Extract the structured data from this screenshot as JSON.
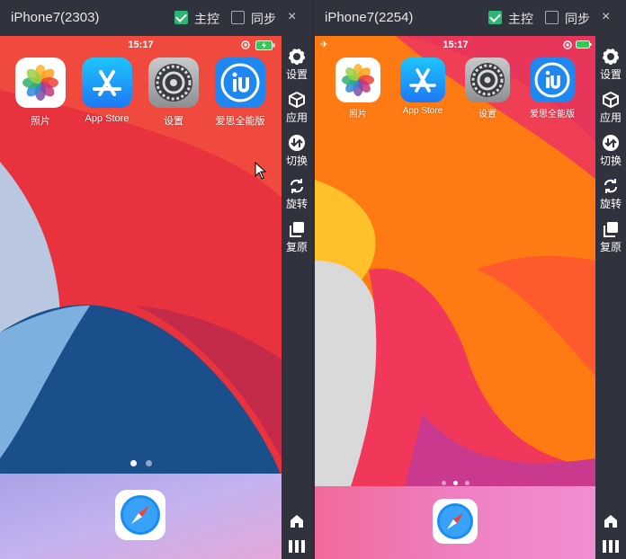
{
  "devices": [
    {
      "title": "iPhone7(2303)",
      "master_label": "主控",
      "master_checked": true,
      "sync_label": "同步",
      "sync_checked": false,
      "close_glyph": "×",
      "status_time": "15:17",
      "apps": [
        "照片",
        "App Store",
        "设置",
        "爱思全能版"
      ],
      "page_count": 2,
      "active_page": 1
    },
    {
      "title": "iPhone7(2254)",
      "master_label": "主控",
      "master_checked": true,
      "sync_label": "同步",
      "sync_checked": false,
      "close_glyph": "×",
      "status_time": "15:17",
      "apps": [
        "照片",
        "App Store",
        "设置",
        "爱思全能版"
      ],
      "page_count": 3,
      "active_page": 2
    }
  ],
  "toolbar": {
    "settings": "设置",
    "apps": "应用",
    "switch": "切换",
    "rotate": "旋转",
    "restore": "复原"
  },
  "colors": {
    "chrome": "#30323d",
    "check_green": "#2bb673",
    "wallpaper_left_red": "#e8323d",
    "wallpaper_left_blue": "#1b4f8c",
    "wallpaper_right_orange": "#ff7a12",
    "wallpaper_right_pink": "#f2385a"
  },
  "icons": [
    "gear-icon",
    "box-icon",
    "swap-icon",
    "rotate-icon",
    "copy-icon",
    "home-icon",
    "menu-icon",
    "safari-icon",
    "airplane-icon",
    "lock-rotation-icon",
    "battery-icon"
  ]
}
